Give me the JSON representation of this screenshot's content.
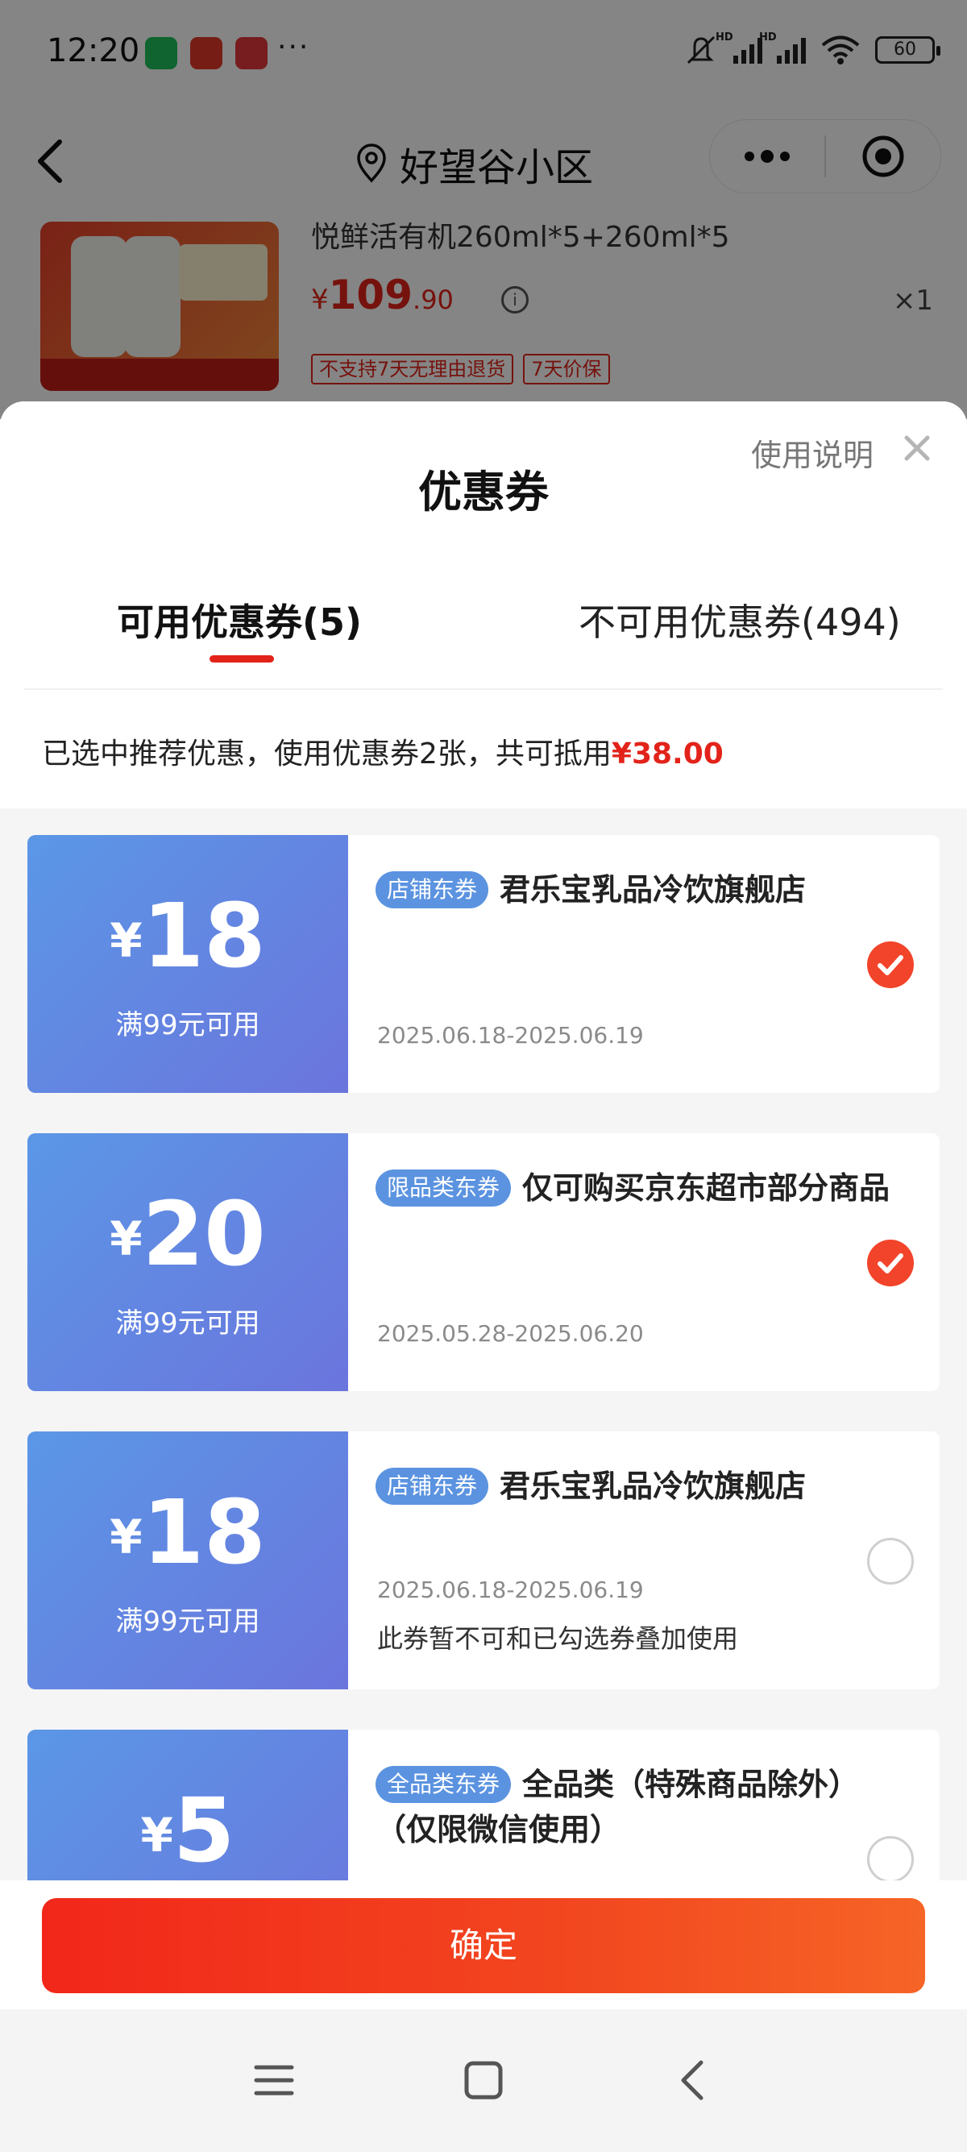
{
  "status_bar": {
    "time": "12:20",
    "more": "···",
    "hd1": "HD",
    "hd2": "HD",
    "battery": "60"
  },
  "nav": {
    "title": "好望谷小区"
  },
  "product": {
    "name": "悦鲜活有机260ml*5+260ml*5",
    "currency": "¥",
    "price_int": "109",
    "price_dec": ".90",
    "qty": "×1",
    "tags": [
      "不支持7天无理由退货",
      "7天价保"
    ]
  },
  "sheet": {
    "title": "优惠券",
    "help": "使用说明",
    "tabs": [
      {
        "label": "可用优惠券(5)",
        "active": true
      },
      {
        "label": "不可用优惠券(494)",
        "active": false
      }
    ],
    "summary_prefix": "已选中推荐优惠，使用优惠券2张，共可抵用",
    "summary_amount": "¥38.00"
  },
  "coupons": [
    {
      "yen": "¥",
      "amount": "18",
      "condition": "满99元可用",
      "tag": "店铺东券",
      "title": "君乐宝乳品冷饮旗舰店",
      "date": "2025.06.18-2025.06.19",
      "note": "",
      "checked": true
    },
    {
      "yen": "¥",
      "amount": "20",
      "condition": "满99元可用",
      "tag": "限品类东券",
      "title": "仅可购买京东超市部分商品",
      "date": "2025.05.28-2025.06.20",
      "note": "",
      "checked": true
    },
    {
      "yen": "¥",
      "amount": "18",
      "condition": "满99元可用",
      "tag": "店铺东券",
      "title": "君乐宝乳品冷饮旗舰店",
      "date": "2025.06.18-2025.06.19",
      "note": "此券暂不可和已勾选券叠加使用",
      "checked": false
    },
    {
      "yen": "¥",
      "amount": "5",
      "condition": "",
      "tag": "全品类东券",
      "title": "全品类（特殊商品除外）（仅限微信使用）",
      "date": "",
      "note": "",
      "checked": false
    }
  ],
  "footer": {
    "confirm": "确定"
  },
  "colors": {
    "accent": "#e2231a",
    "coupon_blue": "#5b97e6",
    "check_red": "#f2442a"
  },
  "icons": [
    "back-arrow-icon",
    "location-pin-icon",
    "more-dots-icon",
    "target-icon",
    "info-icon",
    "close-icon",
    "checkmark-icon",
    "menu-icon",
    "home-square-icon",
    "back-triangle-icon"
  ]
}
